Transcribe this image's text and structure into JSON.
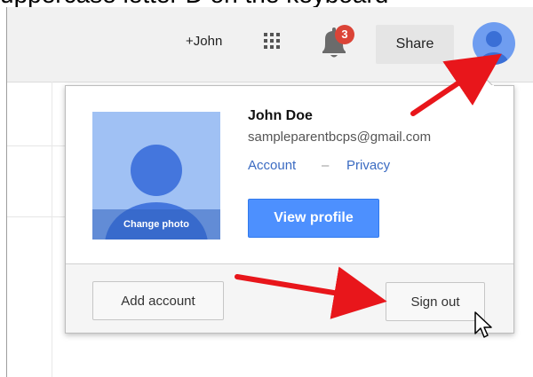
{
  "caption": "uppercase letter D on the keyboard",
  "header": {
    "profile_link": "+John",
    "notification_count": "3",
    "share_label": "Share",
    "icons": [
      "apps-grid-icon",
      "bell-icon",
      "avatar-icon"
    ]
  },
  "account_popup": {
    "change_photo_label": "Change photo",
    "name": "John Doe",
    "email": "sampleparentbcps@gmail.com",
    "account_link": "Account",
    "separator": "–",
    "privacy_link": "Privacy",
    "view_profile_label": "View profile",
    "add_account_label": "Add account",
    "sign_out_label": "Sign out"
  },
  "colors": {
    "primary_button": "#4d90fe",
    "link": "#3b6bc2",
    "badge": "#db4437",
    "avatar": "#4a7fe0",
    "annotation_arrow": "#e8161b"
  }
}
